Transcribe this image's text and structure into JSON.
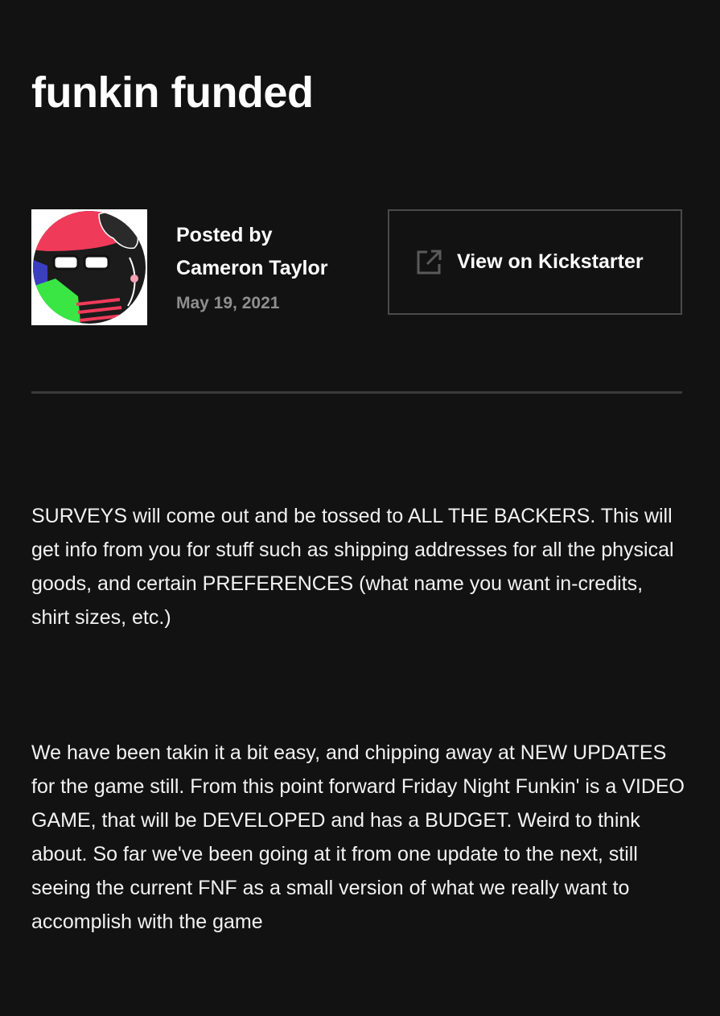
{
  "post": {
    "title": "funkin funded",
    "posted_by_label": "Posted by",
    "author": "Cameron Taylor",
    "date": "May 19, 2021",
    "kickstarter_button_label": "View on Kickstarter",
    "kickstarter_icon": "external-link-icon",
    "paragraphs": [
      "SURVEYS will come out and be tossed to ALL THE BACKERS. This will get info from you for stuff such as shipping addresses for all the physical goods, and certain PREFERENCES (what name you want in-credits, shirt sizes, etc.)",
      "We have been takin it a bit easy, and chipping away at NEW UPDATES for the game still. From this point forward Friday Night Funkin' is a VIDEO GAME, that will be DEVELOPED and has a BUDGET. Weird to think about. So far we've been going at it from one update to the next, still seeing the current FNF as a small version of what we really want to accomplish with the game"
    ]
  },
  "colors": {
    "background": "#121212",
    "text": "#ffffff",
    "muted_text": "#8f8f8f",
    "border": "#4a4a4a",
    "divider": "#3a3a3a"
  }
}
